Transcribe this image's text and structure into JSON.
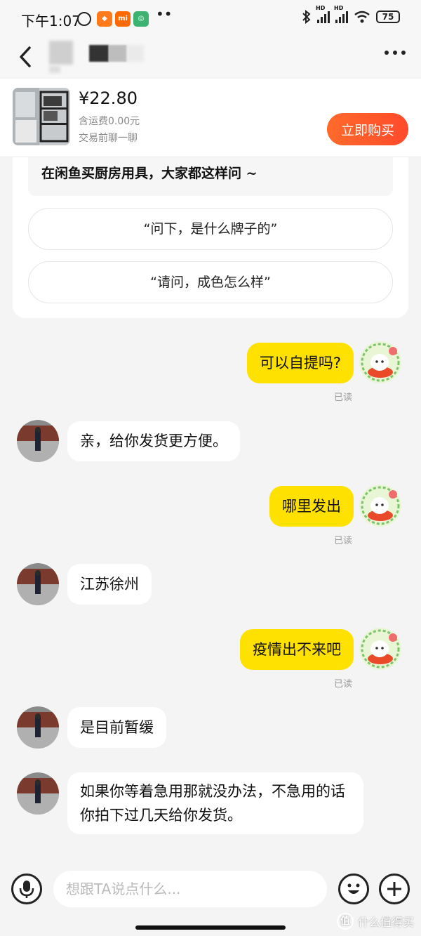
{
  "status_bar": {
    "time": "下午1:07",
    "app_icons": [
      "alarm-icon",
      "app-icon-orange",
      "mi-icon",
      "mijia-icon"
    ],
    "more_dots": "••",
    "hd_label": "HD",
    "battery": "75"
  },
  "nav": {
    "back_icon": "back-icon",
    "more_icon": "more-icon"
  },
  "product": {
    "price": "¥22.80",
    "shipping": "含运费0.00元",
    "chat_note": "交易前聊一聊",
    "buy_label": "立即购买",
    "colors": {
      "buy": "#ff4f2b"
    }
  },
  "suggestions": {
    "title": "在闲鱼买厨房用具，大家都这样问 ~",
    "questions": [
      "“问下，是什么牌子的”",
      "“请问，成色怎么样”"
    ]
  },
  "messages": [
    {
      "dir": "out",
      "text": "可以自提吗?",
      "status": "已读"
    },
    {
      "dir": "in",
      "text": "亲，给你发货更方便。"
    },
    {
      "dir": "out",
      "text": "哪里发出",
      "status": "已读"
    },
    {
      "dir": "in",
      "text": "江苏徐州"
    },
    {
      "dir": "out",
      "text": "疫情出不来吧",
      "status": "已读"
    },
    {
      "dir": "in",
      "text": "是目前暂缓"
    },
    {
      "dir": "in",
      "text": "如果你等着急用那就没办法，不急用的话你拍下过几天给你发货。"
    }
  ],
  "input": {
    "placeholder": "想跟TA说点什么...",
    "mic_icon": "microphone-icon",
    "emoji_icon": "emoji-icon",
    "plus_icon": "plus-icon"
  },
  "watermark": {
    "badge": "值",
    "text": "什么值得买"
  },
  "colors": {
    "self_bubble": "#ffe100",
    "other_bubble": "#ffffff",
    "background": "#f4f4f4"
  }
}
